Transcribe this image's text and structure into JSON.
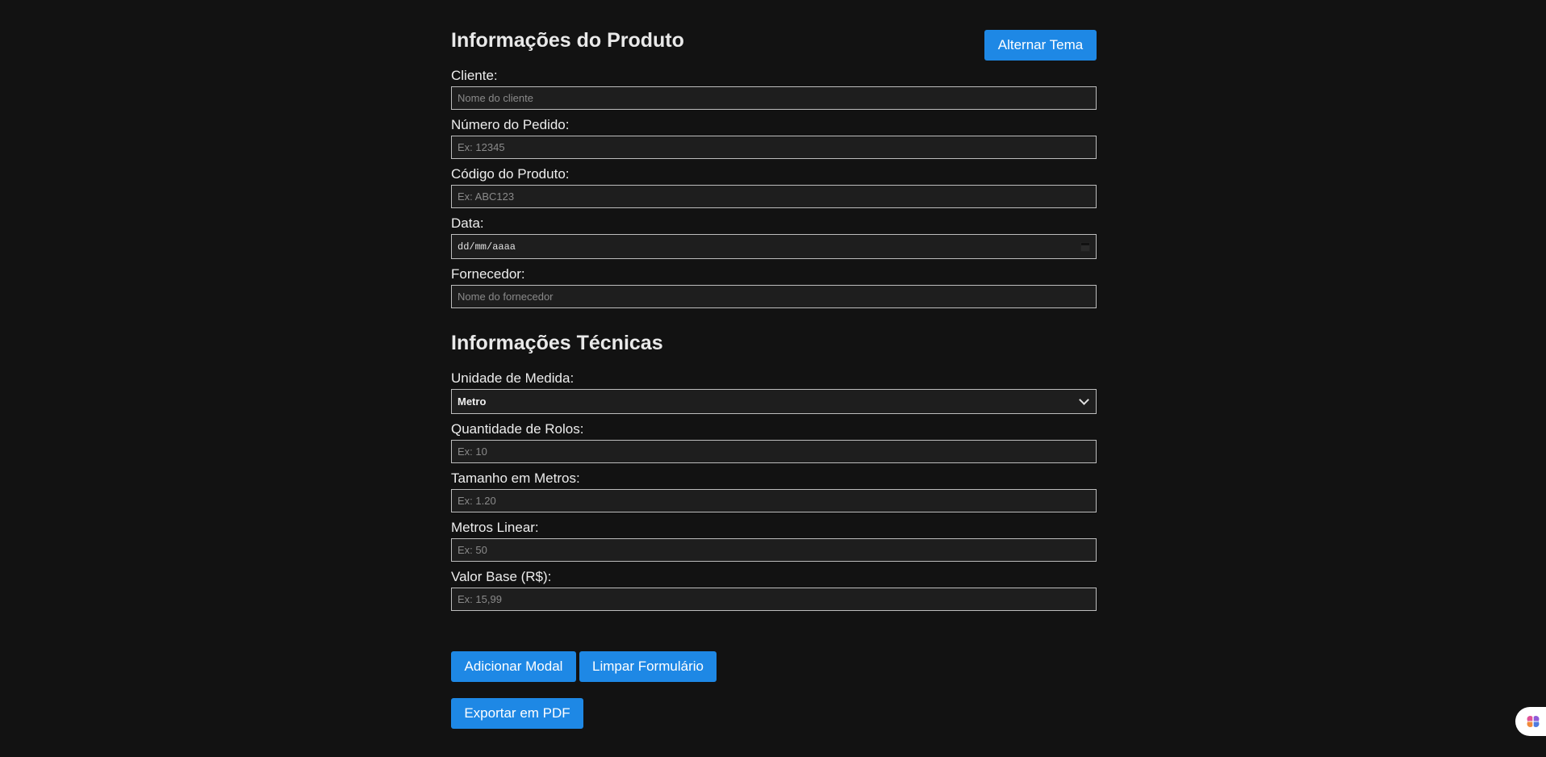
{
  "header": {
    "theme_toggle_label": "Alternar Tema"
  },
  "product_section": {
    "title": "Informações do Produto",
    "fields": {
      "cliente": {
        "label": "Cliente:",
        "placeholder": "Nome do cliente"
      },
      "numero_pedido": {
        "label": "Número do Pedido:",
        "placeholder": "Ex: 12345"
      },
      "codigo_produto": {
        "label": "Código do Produto:",
        "placeholder": "Ex: ABC123"
      },
      "data": {
        "label": "Data:",
        "value": "dd/mm/aaaa"
      },
      "fornecedor": {
        "label": "Fornecedor:",
        "placeholder": "Nome do fornecedor"
      }
    }
  },
  "technical_section": {
    "title": "Informações Técnicas",
    "fields": {
      "unidade_medida": {
        "label": "Unidade de Medida:",
        "selected": "Metro"
      },
      "quantidade_rolos": {
        "label": "Quantidade de Rolos:",
        "placeholder": "Ex: 10"
      },
      "tamanho_metros": {
        "label": "Tamanho em Metros:",
        "placeholder": "Ex: 1.20"
      },
      "metros_linear": {
        "label": "Metros Linear:",
        "placeholder": "Ex: 50"
      },
      "valor_base": {
        "label": "Valor Base (R$):",
        "placeholder": "Ex: 15,99"
      }
    }
  },
  "actions": {
    "add_modal": "Adicionar Modal",
    "clear_form": "Limpar Formulário",
    "export_pdf": "Exportar em PDF"
  },
  "colors": {
    "background": "#121212",
    "accent": "#1e88e5",
    "field_background": "#1e1e1e",
    "field_border": "#bdbdbd"
  },
  "icons": {
    "calendar": "calendar-icon",
    "dropdown": "chevron-down-icon",
    "assistant": "brain-icon"
  }
}
